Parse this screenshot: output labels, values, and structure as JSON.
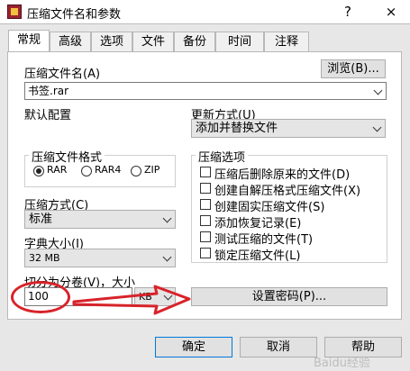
{
  "window": {
    "title": "压缩文件名和参数",
    "help_button": "?",
    "close_button": "×"
  },
  "tabs": [
    "常规",
    "高级",
    "选项",
    "文件",
    "备份",
    "时间",
    "注释"
  ],
  "archive": {
    "name_label": "压缩文件名(A)",
    "browse_button": "浏览(B)...",
    "name_value": "书签.rar"
  },
  "default_profile_label": "默认配置",
  "update": {
    "label": "更新方式(U)",
    "value": "添加并替换文件"
  },
  "format": {
    "label": "压缩文件格式",
    "options": [
      "RAR",
      "RAR4",
      "ZIP"
    ],
    "selected": "RAR"
  },
  "options": {
    "label": "压缩选项",
    "items": [
      "压缩后删除原来的文件(D)",
      "创建自解压格式压缩文件(X)",
      "创建固实压缩文件(S)",
      "添加恢复记录(E)",
      "测试压缩的文件(T)",
      "锁定压缩文件(L)"
    ]
  },
  "method": {
    "label": "压缩方式(C)",
    "value": "标准"
  },
  "dict": {
    "label": "字典大小(I)",
    "value": "32 MB"
  },
  "split": {
    "label": "切分为分卷(V)，大小",
    "value": "100",
    "unit": "KB"
  },
  "password_button": "设置密码(P)...",
  "footer": {
    "ok": "确定",
    "cancel": "取消",
    "help": "帮助"
  },
  "watermark": "Baidu经验",
  "annotation_color": "#d8232a"
}
